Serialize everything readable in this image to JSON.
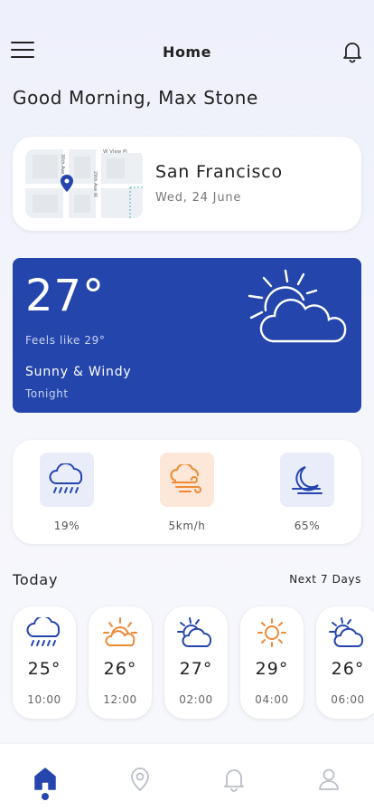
{
  "header": {
    "title": "Home",
    "menu_icon": "menu-icon",
    "notification_icon": "bell-icon"
  },
  "greeting": "Good Morning, Max Stone",
  "location": {
    "city": "San Francisco",
    "date": "Wed, 24 June",
    "map": {
      "street_labels": [
        "W View Pl",
        "30th Ave",
        "29th Ave W"
      ],
      "pin_icon": "map-pin-icon"
    }
  },
  "current": {
    "temperature": "27°",
    "feels_like": "Feels like 29°",
    "condition": "Sunny & Windy",
    "time_of_day": "Tonight",
    "icon": "sun-cloud-icon",
    "card_color": "#2446ac"
  },
  "stats": [
    {
      "icon": "rain-icon",
      "value": "19%",
      "tile_color": "#e9ecf9",
      "icon_color": "#2446ac"
    },
    {
      "icon": "wind-icon",
      "value": "5km/h",
      "tile_color": "#fde7d8",
      "icon_color": "#ee8a36"
    },
    {
      "icon": "moon-icon",
      "value": "65%",
      "tile_color": "#e9ecf9",
      "icon_color": "#2446ac"
    }
  ],
  "today": {
    "label": "Today",
    "next_link": "Next 7 Days"
  },
  "hourly": [
    {
      "icon": "rain-icon",
      "temp": "25°",
      "time": "10:00"
    },
    {
      "icon": "sun-cloud-icon",
      "temp": "26°",
      "time": "12:00"
    },
    {
      "icon": "sun-cloud-icon",
      "temp": "27°",
      "time": "02:00"
    },
    {
      "icon": "sun-icon",
      "temp": "29°",
      "time": "04:00"
    },
    {
      "icon": "sun-cloud-icon",
      "temp": "26°",
      "time": "06:00"
    }
  ],
  "nav": [
    {
      "icon": "home-icon",
      "active": true
    },
    {
      "icon": "location-icon",
      "active": false
    },
    {
      "icon": "bell-icon",
      "active": false
    },
    {
      "icon": "profile-icon",
      "active": false
    }
  ],
  "colors": {
    "accent": "#2446ac",
    "orange": "#ee8a36"
  }
}
